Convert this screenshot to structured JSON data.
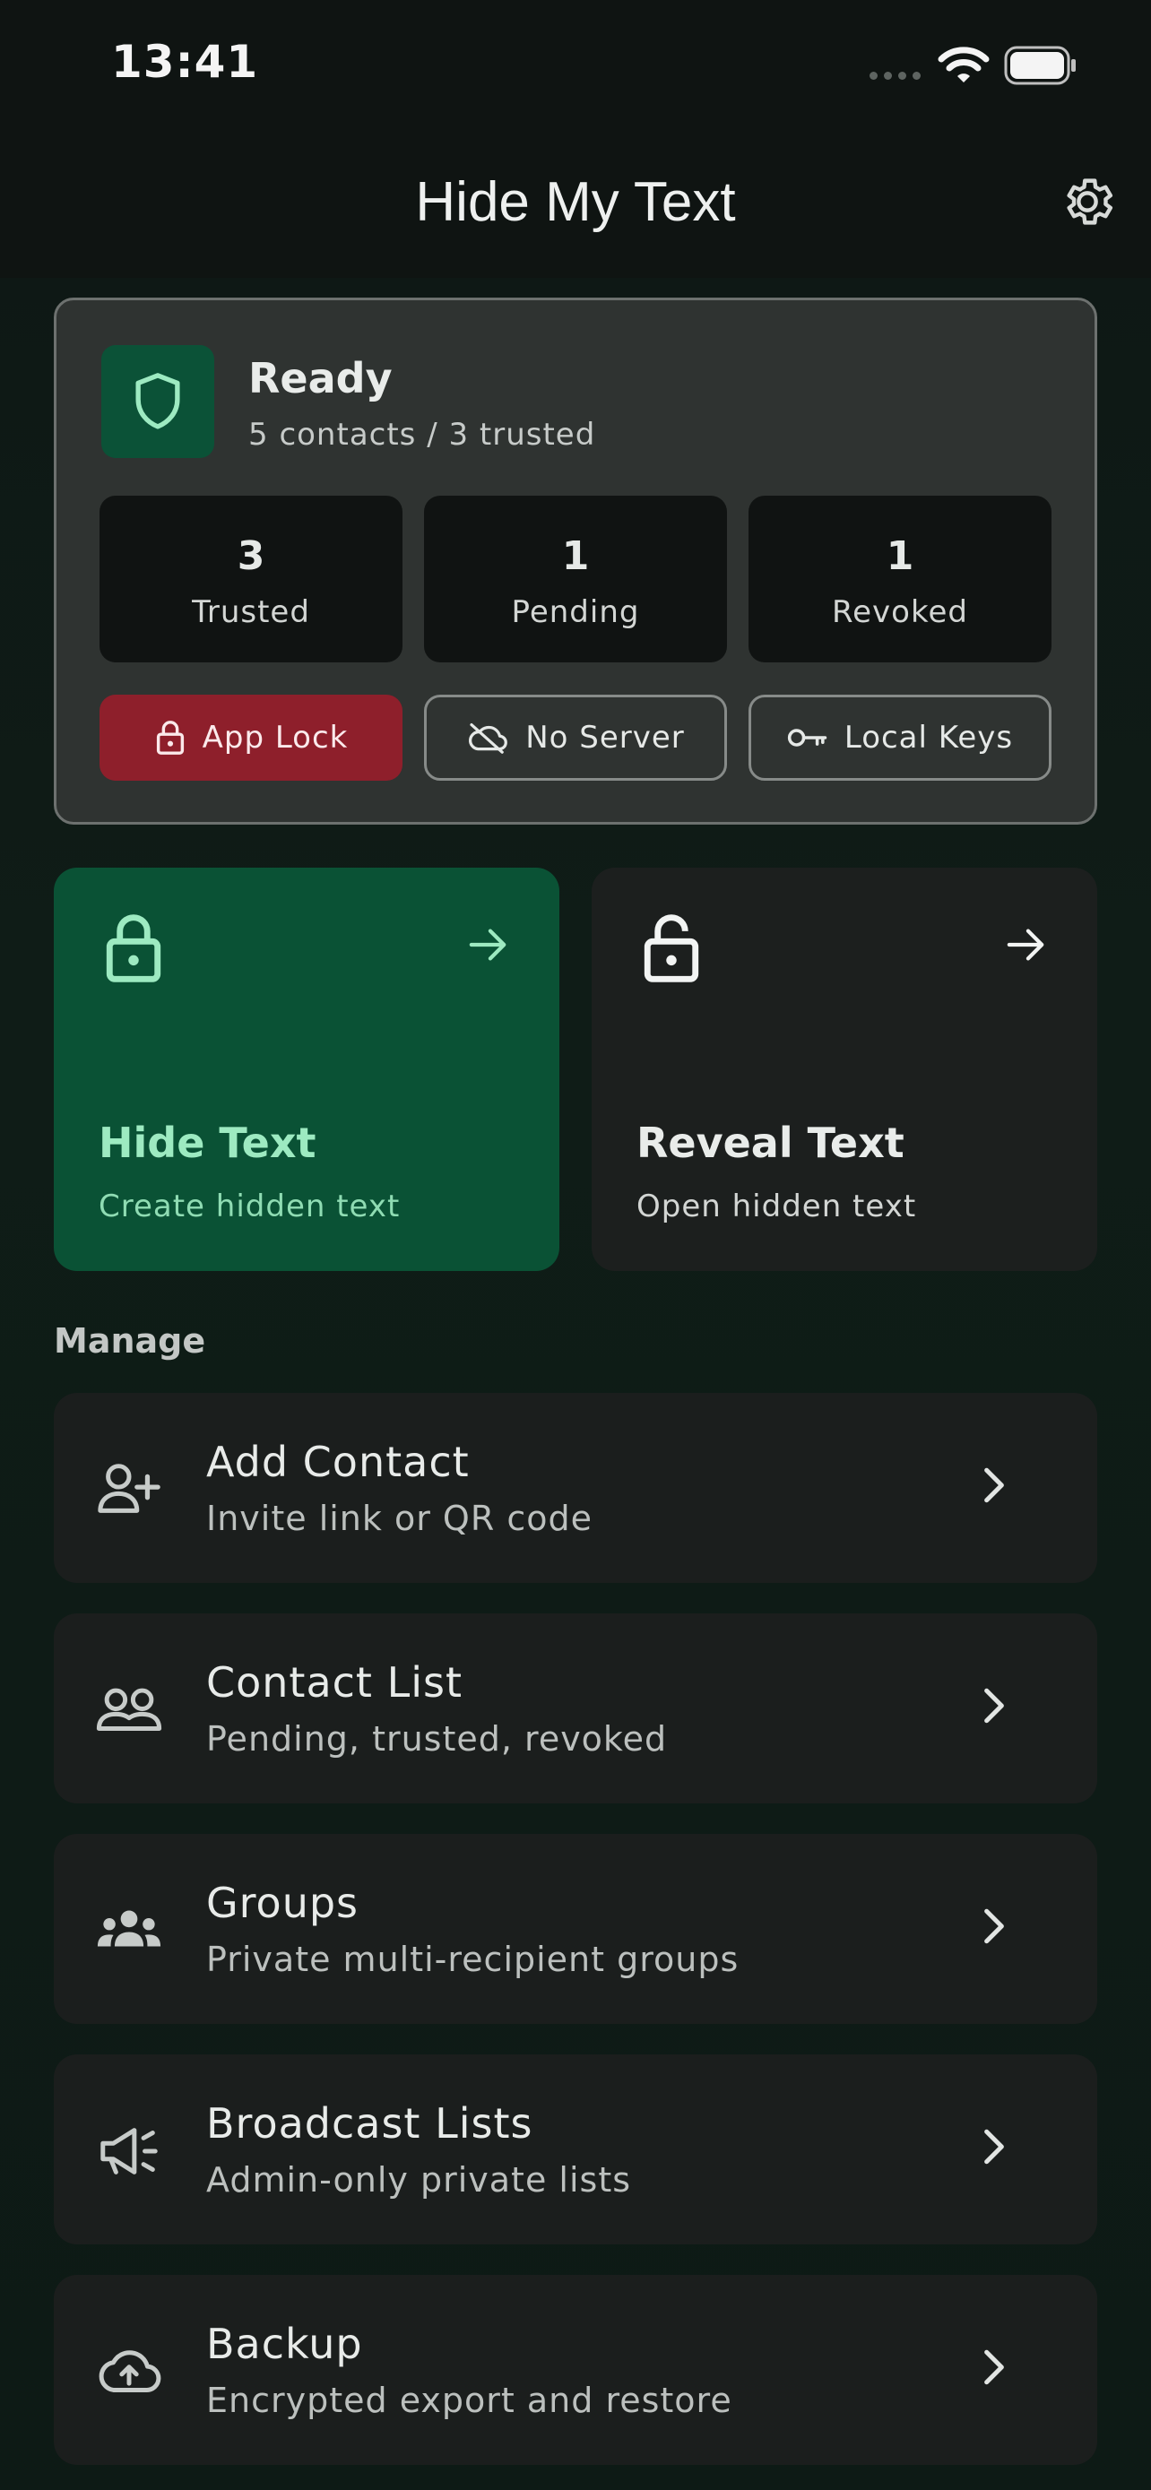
{
  "status_bar": {
    "time": "13:41"
  },
  "header": {
    "title": "Hide My Text"
  },
  "status_card": {
    "title": "Ready",
    "subtitle": "5 contacts / 3 trusted",
    "stats": [
      {
        "value": "3",
        "label": "Trusted"
      },
      {
        "value": "1",
        "label": "Pending"
      },
      {
        "value": "1",
        "label": "Revoked"
      }
    ],
    "chips": [
      {
        "label": "App Lock",
        "icon": "lock-icon"
      },
      {
        "label": "No Server",
        "icon": "cloud-off-icon"
      },
      {
        "label": "Local Keys",
        "icon": "key-icon"
      }
    ]
  },
  "actions": {
    "hide": {
      "title": "Hide Text",
      "subtitle": "Create hidden text"
    },
    "reveal": {
      "title": "Reveal Text",
      "subtitle": "Open hidden text"
    }
  },
  "manage": {
    "title": "Manage",
    "items": [
      {
        "title": "Add Contact",
        "subtitle": "Invite link or QR code",
        "icon": "person-add-icon"
      },
      {
        "title": "Contact List",
        "subtitle": "Pending, trusted, revoked",
        "icon": "people-icon"
      },
      {
        "title": "Groups",
        "subtitle": "Private multi-recipient groups",
        "icon": "groups-icon"
      },
      {
        "title": "Broadcast Lists",
        "subtitle": "Admin-only private lists",
        "icon": "megaphone-icon"
      },
      {
        "title": "Backup",
        "subtitle": "Encrypted export and restore",
        "icon": "cloud-upload-icon"
      }
    ]
  },
  "colors": {
    "accent_green": "#0a5235",
    "accent_green_text": "#9deac1",
    "danger_red": "#8e1f2b",
    "card_bg": "#1b1e1d"
  }
}
